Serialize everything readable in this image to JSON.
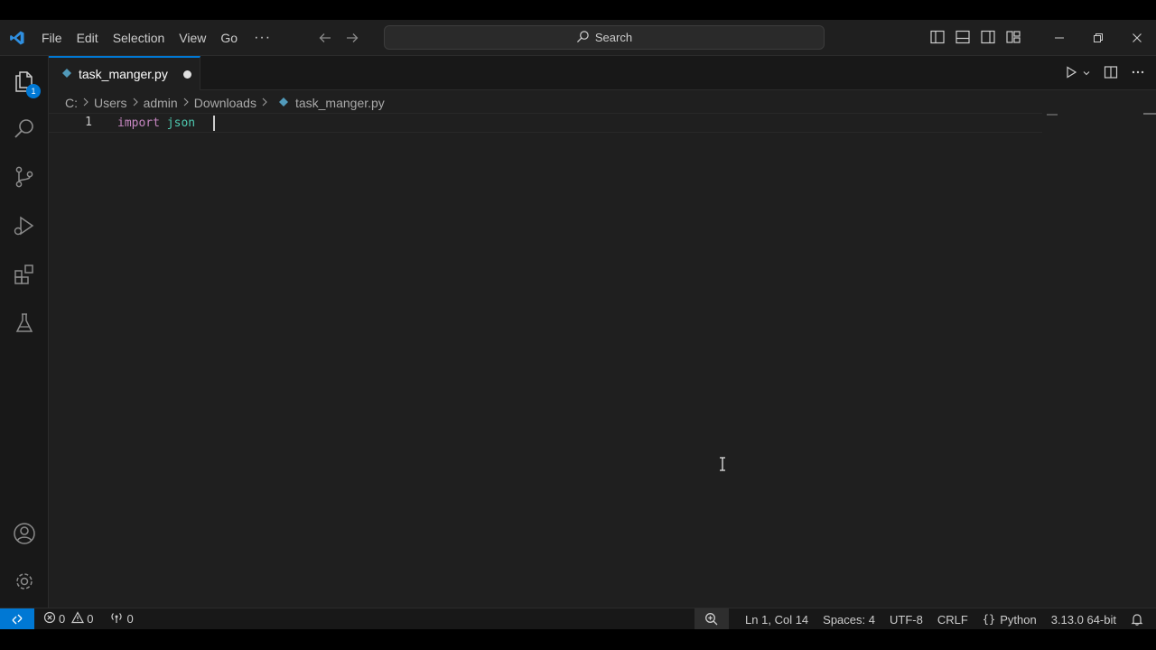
{
  "titlebar": {
    "menu": [
      "File",
      "Edit",
      "Selection",
      "View",
      "Go"
    ],
    "more_label": "···",
    "search_placeholder": "Search"
  },
  "activity": {
    "explorer_badge": "1"
  },
  "tab": {
    "filename": "task_manger.py"
  },
  "breadcrumb": {
    "drive": "C:",
    "users": "Users",
    "admin": "admin",
    "downloads": "Downloads",
    "file": "task_manger.py"
  },
  "editor": {
    "line_number": "1",
    "keyword": "import",
    "module": "json"
  },
  "status": {
    "errors": "0",
    "warnings": "0",
    "ports": "0",
    "position": "Ln 1, Col 14",
    "spaces": "Spaces: 4",
    "encoding": "UTF-8",
    "eol": "CRLF",
    "language": "Python",
    "interpreter": "3.13.0 64-bit"
  },
  "colors": {
    "accent": "#0078d4",
    "keyword": "#c586c0",
    "module": "#4ec9b0",
    "editor_bg": "#1f1f1f"
  }
}
